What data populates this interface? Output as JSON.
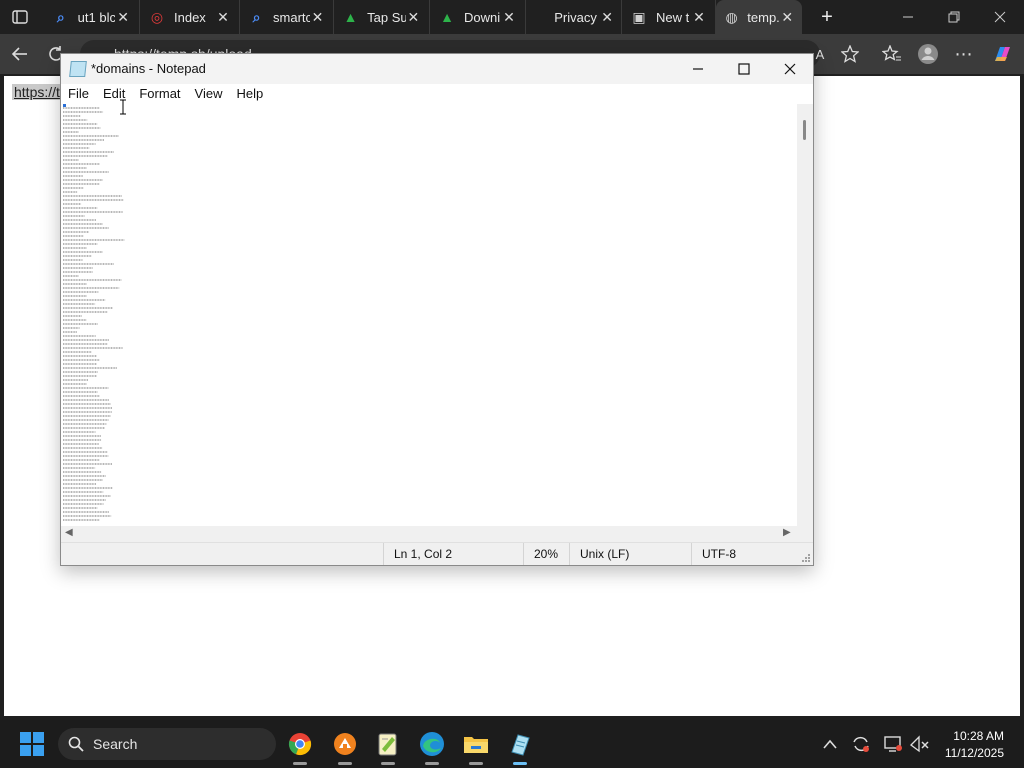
{
  "browser": {
    "tabs": [
      {
        "icon": "search-icon",
        "title": "ut1 blc",
        "color": "#4b8bf5",
        "active": false
      },
      {
        "icon": "opera-icon",
        "title": "Index",
        "color": "#e03a3a",
        "active": false
      },
      {
        "icon": "search-icon",
        "title": "smartc",
        "color": "#4b8bf5",
        "active": false
      },
      {
        "icon": "tapsu-icon",
        "title": "Tap Su",
        "color": "#2db34a",
        "active": false
      },
      {
        "icon": "downie-icon",
        "title": "Downi",
        "color": "#2db34a",
        "active": false
      },
      {
        "icon": "privacy-icon",
        "title": "Privacy erro",
        "color": "#d0d0d0",
        "active": false
      },
      {
        "icon": "newtab-icon",
        "title": "New t",
        "color": "#d0d0d0",
        "active": false
      },
      {
        "icon": "globe-icon",
        "title": "temp.s",
        "color": "#d0d0d0",
        "active": true
      }
    ],
    "address": "https://temp.sh/upload",
    "page_url_text": "https://t"
  },
  "notepad": {
    "title": "*domains - Notepad",
    "menu": [
      "File",
      "Edit",
      "Format",
      "View",
      "Help"
    ],
    "status": {
      "position": "Ln 1, Col 2",
      "zoom": "20%",
      "line_ending": "Unix (LF)",
      "encoding": "UTF-8"
    }
  },
  "taskbar": {
    "search_label": "Search",
    "apps": [
      "chrome-icon",
      "tool-icon",
      "notepadpp-icon",
      "edge-icon",
      "file-explorer-icon",
      "notepad-icon"
    ],
    "time": "10:28 AM",
    "date": "11/12/2025"
  }
}
